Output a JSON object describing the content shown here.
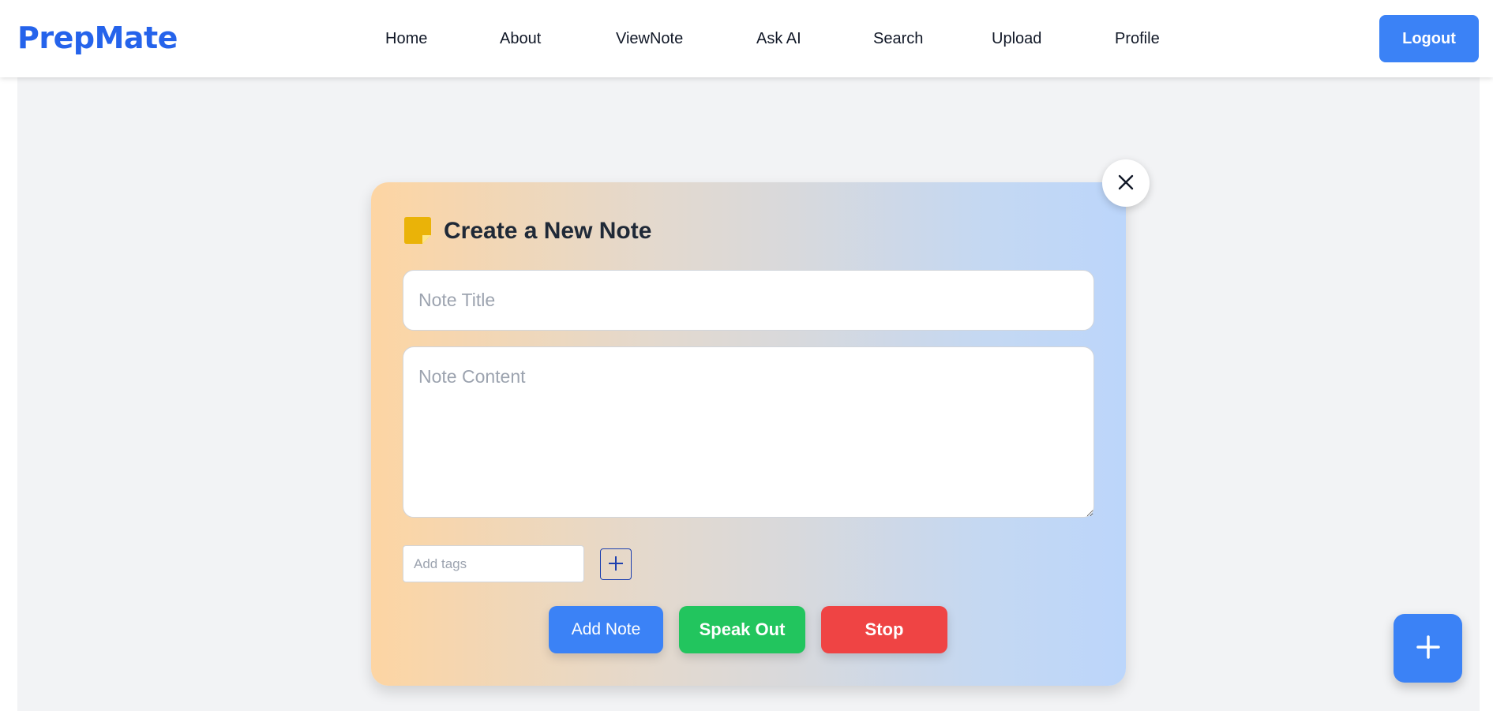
{
  "app": {
    "brand": "PrepMate"
  },
  "nav": {
    "items": [
      {
        "label": "Home"
      },
      {
        "label": "About"
      },
      {
        "label": "ViewNote"
      },
      {
        "label": "Ask AI"
      },
      {
        "label": "Search"
      },
      {
        "label": "Upload"
      },
      {
        "label": "Profile"
      }
    ],
    "logout_label": "Logout"
  },
  "modal": {
    "title": "Create a New Note",
    "title_field": {
      "value": "",
      "placeholder": "Note Title"
    },
    "content_field": {
      "value": "",
      "placeholder": "Note Content"
    },
    "tags_field": {
      "value": "",
      "placeholder": "Add tags"
    },
    "buttons": {
      "add_note": "Add Note",
      "speak_out": "Speak Out",
      "stop": "Stop"
    },
    "icons": {
      "note": "sticky-note-icon",
      "close": "close-icon",
      "add_tag": "plus-icon"
    }
  },
  "fab": {
    "icon": "plus-icon"
  },
  "colors": {
    "brand": "#2563eb",
    "primary": "#3b82f6",
    "success": "#22c55e",
    "danger": "#ef4444",
    "note_icon": "#eab308"
  }
}
